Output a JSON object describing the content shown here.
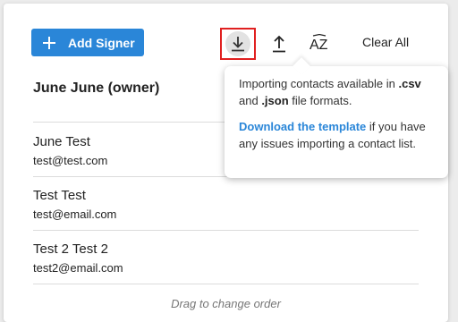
{
  "toolbar": {
    "add_signer_label": "Add Signer",
    "clear_all_label": "Clear All",
    "download_icon": "download-icon",
    "upload_icon": "upload-icon",
    "sort_icon": "sort-az-icon",
    "sort_glyph": "AZ"
  },
  "owner": {
    "label": "June June (owner)"
  },
  "signers": [
    {
      "name": "June Test",
      "email": "test@test.com"
    },
    {
      "name": "Test Test",
      "email": "test@email.com"
    },
    {
      "name": "Test 2 Test 2",
      "email": "test2@email.com"
    }
  ],
  "footer": {
    "drag_hint": "Drag to change order"
  },
  "tooltip": {
    "line1_pre": "Importing contacts available in ",
    "csv": ".csv",
    "line1_mid": " and ",
    "json": ".json",
    "line1_post": " file formats.",
    "link_label": "Download the template",
    "line2_post": " if you have any issues importing a contact list."
  },
  "colors": {
    "accent": "#2a86d8",
    "highlight_border": "#e02020"
  }
}
